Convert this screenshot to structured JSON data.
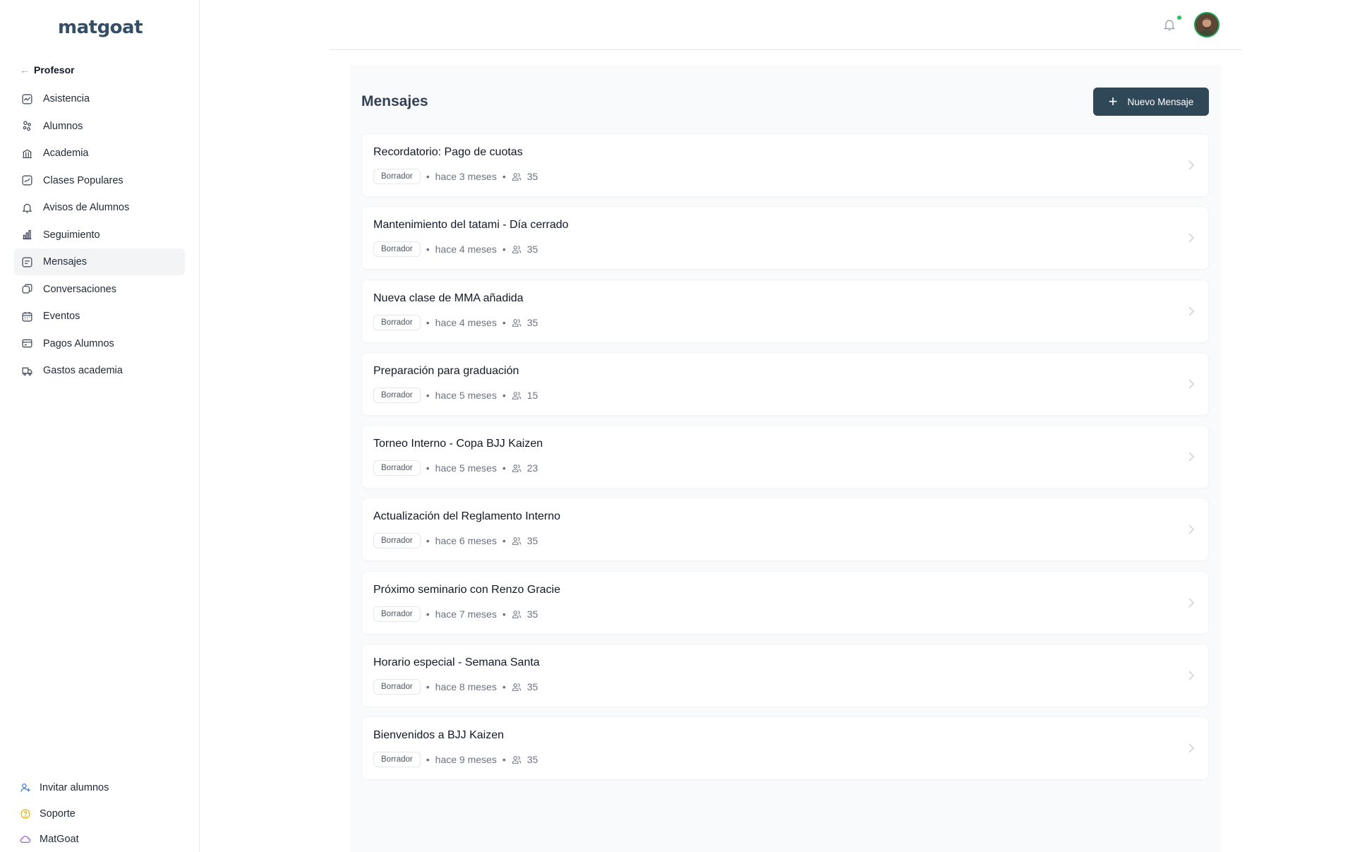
{
  "brand": {
    "logo_text": "matgoat"
  },
  "sidebar": {
    "back_label": "Profesor",
    "items": [
      {
        "label": "Asistencia",
        "icon": "activity-icon"
      },
      {
        "label": "Alumnos",
        "icon": "users-icon"
      },
      {
        "label": "Academia",
        "icon": "building-icon"
      },
      {
        "label": "Clases Populares",
        "icon": "trend-icon"
      },
      {
        "label": "Avisos de Alumnos",
        "icon": "bell-icon"
      },
      {
        "label": "Seguimiento",
        "icon": "bar-chart-icon"
      },
      {
        "label": "Mensajes",
        "icon": "message-icon",
        "active": true
      },
      {
        "label": "Conversaciones",
        "icon": "chat-icon"
      },
      {
        "label": "Eventos",
        "icon": "calendar-icon"
      },
      {
        "label": "Pagos Alumnos",
        "icon": "credit-card-icon"
      },
      {
        "label": "Gastos academia",
        "icon": "truck-icon"
      }
    ],
    "bottom": [
      {
        "label": "Invitar alumnos",
        "icon": "user-plus-icon",
        "color": "#3b82f6"
      },
      {
        "label": "Soporte",
        "icon": "help-circle-icon",
        "color": "#eab308"
      },
      {
        "label": "MatGoat",
        "icon": "cloud-icon",
        "color": "#8b5cf6"
      }
    ]
  },
  "header": {
    "notification_indicator_color": "#22c55e"
  },
  "main": {
    "title": "Mensajes",
    "new_button_label": "Nuevo Mensaje",
    "messages": [
      {
        "title": "Recordatorio: Pago de cuotas",
        "status": "Borrador",
        "time": "hace 3 meses",
        "recipients": "35"
      },
      {
        "title": "Mantenimiento del tatami - Día cerrado",
        "status": "Borrador",
        "time": "hace 4 meses",
        "recipients": "35"
      },
      {
        "title": "Nueva clase de MMA añadida",
        "status": "Borrador",
        "time": "hace 4 meses",
        "recipients": "35"
      },
      {
        "title": "Preparación para graduación",
        "status": "Borrador",
        "time": "hace 5 meses",
        "recipients": "15"
      },
      {
        "title": "Torneo Interno - Copa BJJ Kaizen",
        "status": "Borrador",
        "time": "hace 5 meses",
        "recipients": "23"
      },
      {
        "title": "Actualización del Reglamento Interno",
        "status": "Borrador",
        "time": "hace 6 meses",
        "recipients": "35"
      },
      {
        "title": "Próximo seminario con Renzo Gracie",
        "status": "Borrador",
        "time": "hace 7 meses",
        "recipients": "35"
      },
      {
        "title": "Horario especial - Semana Santa",
        "status": "Borrador",
        "time": "hace 8 meses",
        "recipients": "35"
      },
      {
        "title": "Bienvenidos a BJJ Kaizen",
        "status": "Borrador",
        "time": "hace 9 meses",
        "recipients": "35"
      }
    ]
  },
  "colors": {
    "primary_button": "#2f4858",
    "active_nav_bg": "#f3f4f6",
    "panel_bg": "#f9fafb"
  }
}
